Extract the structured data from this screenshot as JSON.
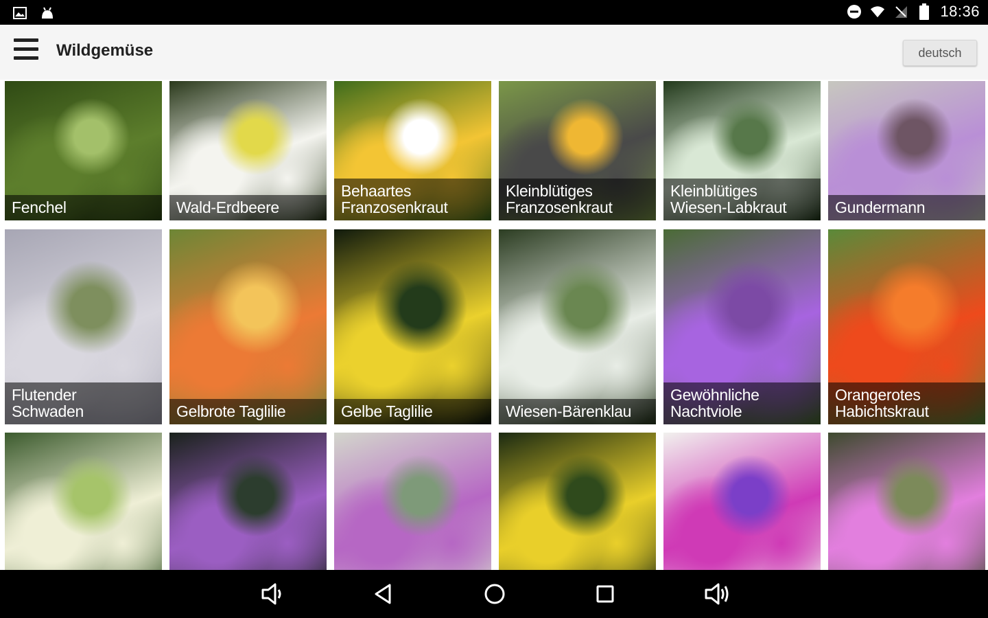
{
  "status_bar": {
    "time": "18:36",
    "left_icons": [
      "picture-icon",
      "android-icon"
    ],
    "right_icons": [
      "do-not-disturb-icon",
      "wifi-icon",
      "no-signal-icon",
      "battery-icon"
    ]
  },
  "app_bar": {
    "title": "Wildgemüse",
    "language_button": "deutsch"
  },
  "plants": [
    {
      "name": "Fenchel",
      "colors": [
        "#5d7e2c",
        "#a3c06a",
        "#2f4a14"
      ]
    },
    {
      "name": "Wald-Erdbeere",
      "colors": [
        "#f4f4ef",
        "#e2d94a",
        "#2b3a1c"
      ]
    },
    {
      "name": "Behaartes\nFranzosenkraut",
      "colors": [
        "#f3c534",
        "#ffffff",
        "#3e6c1c"
      ]
    },
    {
      "name": "Kleinblütiges\nFranzosenkraut",
      "colors": [
        "#494949",
        "#efb733",
        "#7b9748"
      ]
    },
    {
      "name": "Kleinblütiges\nWiesen-Labkraut",
      "colors": [
        "#d9e8d5",
        "#57784a",
        "#233a1c"
      ]
    },
    {
      "name": "Gundermann",
      "colors": [
        "#b98fd6",
        "#6e5564",
        "#c7c7bf"
      ]
    },
    {
      "name": "Flutender\nSchwaden",
      "colors": [
        "#d9d7df",
        "#7e8f5e",
        "#a7a6b4"
      ]
    },
    {
      "name": "Gelbrote Taglilie",
      "colors": [
        "#ec7a35",
        "#f3c45a",
        "#6d8636"
      ]
    },
    {
      "name": "Gelbe Taglilie",
      "colors": [
        "#ebd12d",
        "#233b1b",
        "#101a0d"
      ]
    },
    {
      "name": "Wiesen-Bärenklau",
      "colors": [
        "#e8ede6",
        "#6a8751",
        "#2c3d22"
      ]
    },
    {
      "name": "Gewöhnliche\nNachtviole",
      "colors": [
        "#a764e0",
        "#7c4aa5",
        "#4a6b35"
      ]
    },
    {
      "name": "Orangerotes\nHabichtskraut",
      "colors": [
        "#ee4a1c",
        "#f57c2b",
        "#5a8a3a"
      ]
    },
    {
      "name": "",
      "colors": [
        "#efefd6",
        "#a6c46a",
        "#3c5b2e"
      ]
    },
    {
      "name": "",
      "colors": [
        "#9b5ec2",
        "#2c3d2e",
        "#1a221c"
      ]
    },
    {
      "name": "",
      "colors": [
        "#b667c4",
        "#7e9a79",
        "#d3d6cc"
      ]
    },
    {
      "name": "",
      "colors": [
        "#e9cf2a",
        "#2f4a1c",
        "#1b2a12"
      ]
    },
    {
      "name": "",
      "colors": [
        "#cf3ab6",
        "#7b3fc8",
        "#f1f1ee"
      ]
    },
    {
      "name": "",
      "colors": [
        "#e27fde",
        "#7c8a5a",
        "#3e4a2e"
      ]
    }
  ],
  "nav_bar": {
    "buttons": [
      "volume-down-icon",
      "back-icon",
      "home-icon",
      "recents-icon",
      "volume-up-icon"
    ]
  }
}
